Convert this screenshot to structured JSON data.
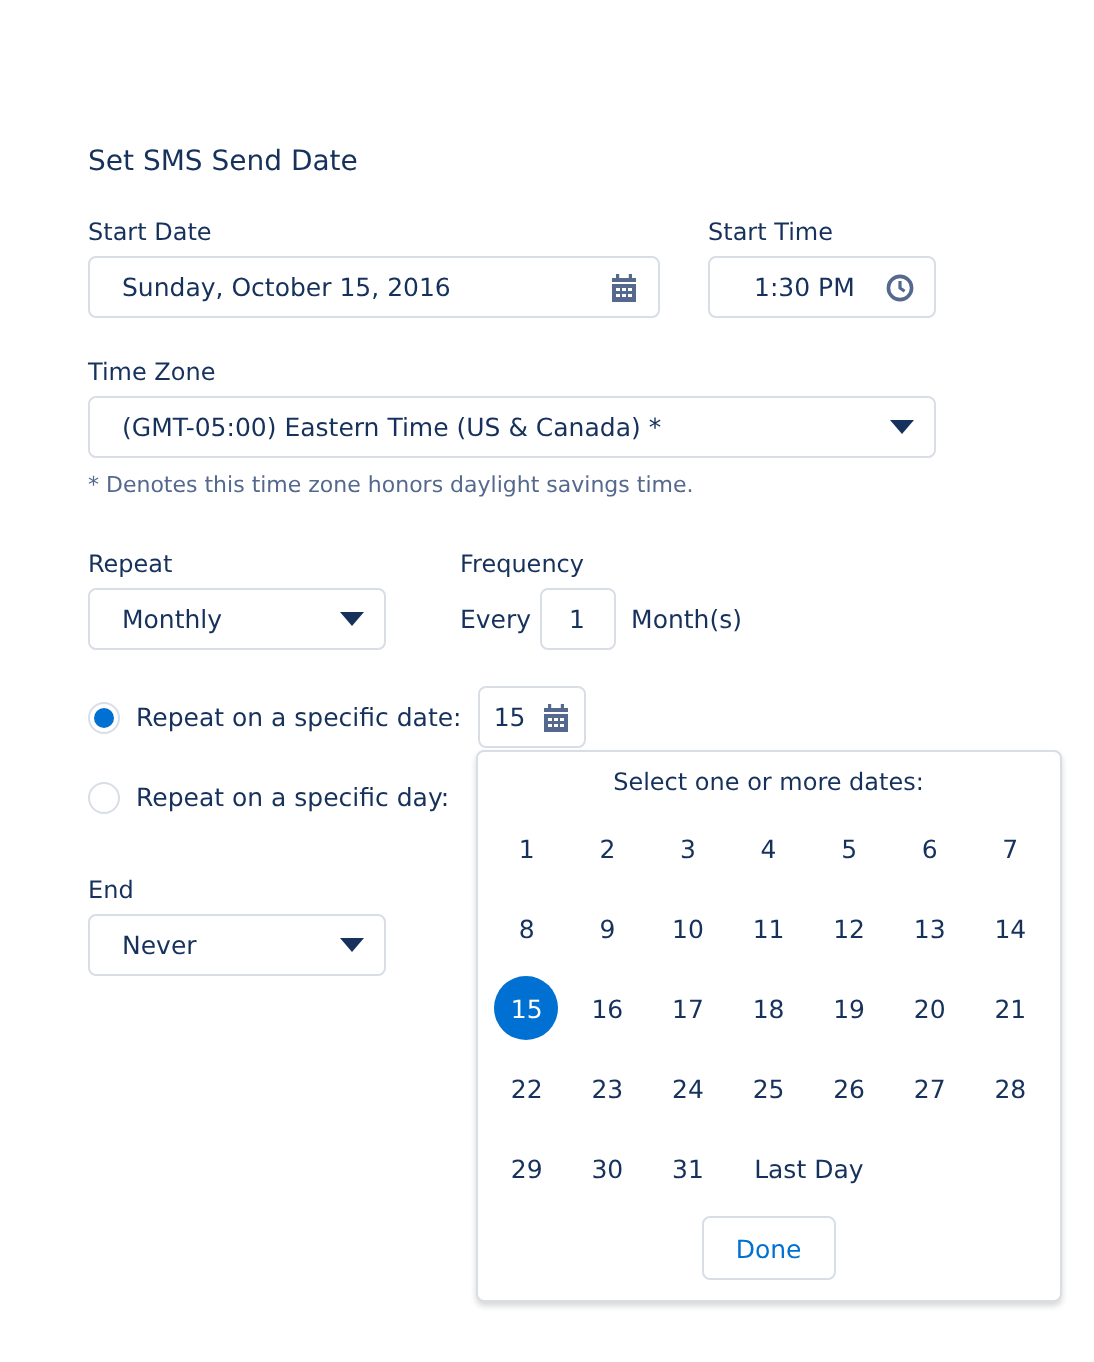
{
  "title": "Set SMS Send Date",
  "start_date": {
    "label": "Start Date",
    "value": "Sunday, October 15, 2016"
  },
  "start_time": {
    "label": "Start Time",
    "value": "1:30 PM"
  },
  "time_zone": {
    "label": "Time Zone",
    "value": "(GMT-05:00) Eastern Time (US & Canada) *",
    "note": "* Denotes this time zone honors daylight savings time."
  },
  "repeat": {
    "label": "Repeat",
    "value": "Monthly"
  },
  "frequency": {
    "label": "Frequency",
    "prefix": "Every",
    "value": "1",
    "suffix": "Month(s)"
  },
  "repeat_options": [
    {
      "label": "Repeat on a specific date:",
      "selected": true,
      "value": "15"
    },
    {
      "label": "Repeat on a specific day:",
      "selected": false
    }
  ],
  "date_picker": {
    "title": "Select one or more dates:",
    "button": "Done",
    "days": [
      {
        "label": "1",
        "kind": "day",
        "selected": false
      },
      {
        "label": "2",
        "kind": "day",
        "selected": false
      },
      {
        "label": "3",
        "kind": "day",
        "selected": false
      },
      {
        "label": "4",
        "kind": "day",
        "selected": false
      },
      {
        "label": "5",
        "kind": "day",
        "selected": false
      },
      {
        "label": "6",
        "kind": "day",
        "selected": false
      },
      {
        "label": "7",
        "kind": "day",
        "selected": false
      },
      {
        "label": "8",
        "kind": "day",
        "selected": false
      },
      {
        "label": "9",
        "kind": "day",
        "selected": false
      },
      {
        "label": "10",
        "kind": "day",
        "selected": false
      },
      {
        "label": "11",
        "kind": "day",
        "selected": false
      },
      {
        "label": "12",
        "kind": "day",
        "selected": false
      },
      {
        "label": "13",
        "kind": "day",
        "selected": false
      },
      {
        "label": "14",
        "kind": "day",
        "selected": false
      },
      {
        "label": "15",
        "kind": "day",
        "selected": true
      },
      {
        "label": "16",
        "kind": "day",
        "selected": false
      },
      {
        "label": "17",
        "kind": "day",
        "selected": false
      },
      {
        "label": "18",
        "kind": "day",
        "selected": false
      },
      {
        "label": "19",
        "kind": "day",
        "selected": false
      },
      {
        "label": "20",
        "kind": "day",
        "selected": false
      },
      {
        "label": "21",
        "kind": "day",
        "selected": false
      },
      {
        "label": "22",
        "kind": "day",
        "selected": false
      },
      {
        "label": "23",
        "kind": "day",
        "selected": false
      },
      {
        "label": "24",
        "kind": "day",
        "selected": false
      },
      {
        "label": "25",
        "kind": "day",
        "selected": false
      },
      {
        "label": "26",
        "kind": "day",
        "selected": false
      },
      {
        "label": "27",
        "kind": "day",
        "selected": false
      },
      {
        "label": "28",
        "kind": "day",
        "selected": false
      },
      {
        "label": "29",
        "kind": "day",
        "selected": false
      },
      {
        "label": "30",
        "kind": "day",
        "selected": false
      },
      {
        "label": "31",
        "kind": "day",
        "selected": false
      },
      {
        "label": "Last Day",
        "kind": "last",
        "selected": false
      }
    ]
  },
  "end": {
    "label": "End",
    "value": "Never"
  }
}
